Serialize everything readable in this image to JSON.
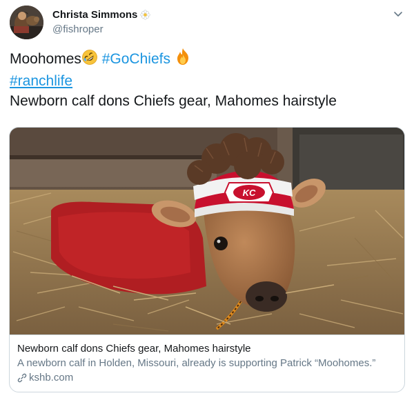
{
  "user": {
    "display_name": "Christa Simmons",
    "handle": "@fishroper",
    "name_emoji_icon": "white-flower-icon"
  },
  "tweet": {
    "word_moohomes": "Moohomes",
    "emoji_laughing": "rolling-on-floor-laughing-icon",
    "hashtag_gochiefs": "#GoChiefs",
    "emoji_fire": "fire-icon",
    "hashtag_ranchlife": "#ranchlife",
    "text_line3": "Newborn calf dons Chiefs gear, Mahomes hairstyle"
  },
  "card": {
    "image_alt": "Newborn calf in red Chiefs shirt and hat lying in straw",
    "title": "Newborn calf dons Chiefs gear, Mahomes hairstyle",
    "description": "A newborn calf in Holden, Missouri, already is supporting Patrick “Moohomes.”",
    "domain": "kshb.com",
    "hat_logo_text": "KC"
  },
  "colors": {
    "link": "#1b95e0",
    "text": "#14171a",
    "secondary": "#657786",
    "border": "#ccd6dd",
    "chiefs_red": "#c8102e"
  }
}
